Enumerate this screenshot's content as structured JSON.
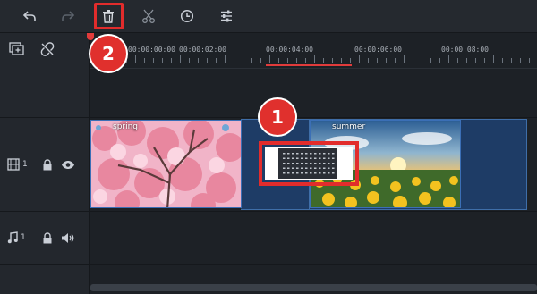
{
  "toolbar": {
    "buttons": [
      {
        "name": "undo-icon"
      },
      {
        "name": "redo-icon"
      },
      {
        "name": "delete-icon"
      },
      {
        "name": "cut-icon"
      },
      {
        "name": "duration-icon"
      },
      {
        "name": "adjust-icon"
      }
    ]
  },
  "ruler": {
    "labels": [
      "00:00:00:00",
      "00:00:02:00",
      "00:00:04:00",
      "00:00:06:00",
      "00:00:08:00"
    ]
  },
  "tracks": {
    "video": {
      "number": "1",
      "clips": [
        {
          "name": "spring"
        },
        {
          "name": "summer"
        }
      ]
    },
    "audio": {
      "number": "1"
    }
  },
  "annotations": {
    "badge1": "1",
    "badge2": "2"
  },
  "colors": {
    "accent_red": "#e22c2c",
    "clip_blue": "#1e3c66",
    "background": "#1d2126"
  }
}
